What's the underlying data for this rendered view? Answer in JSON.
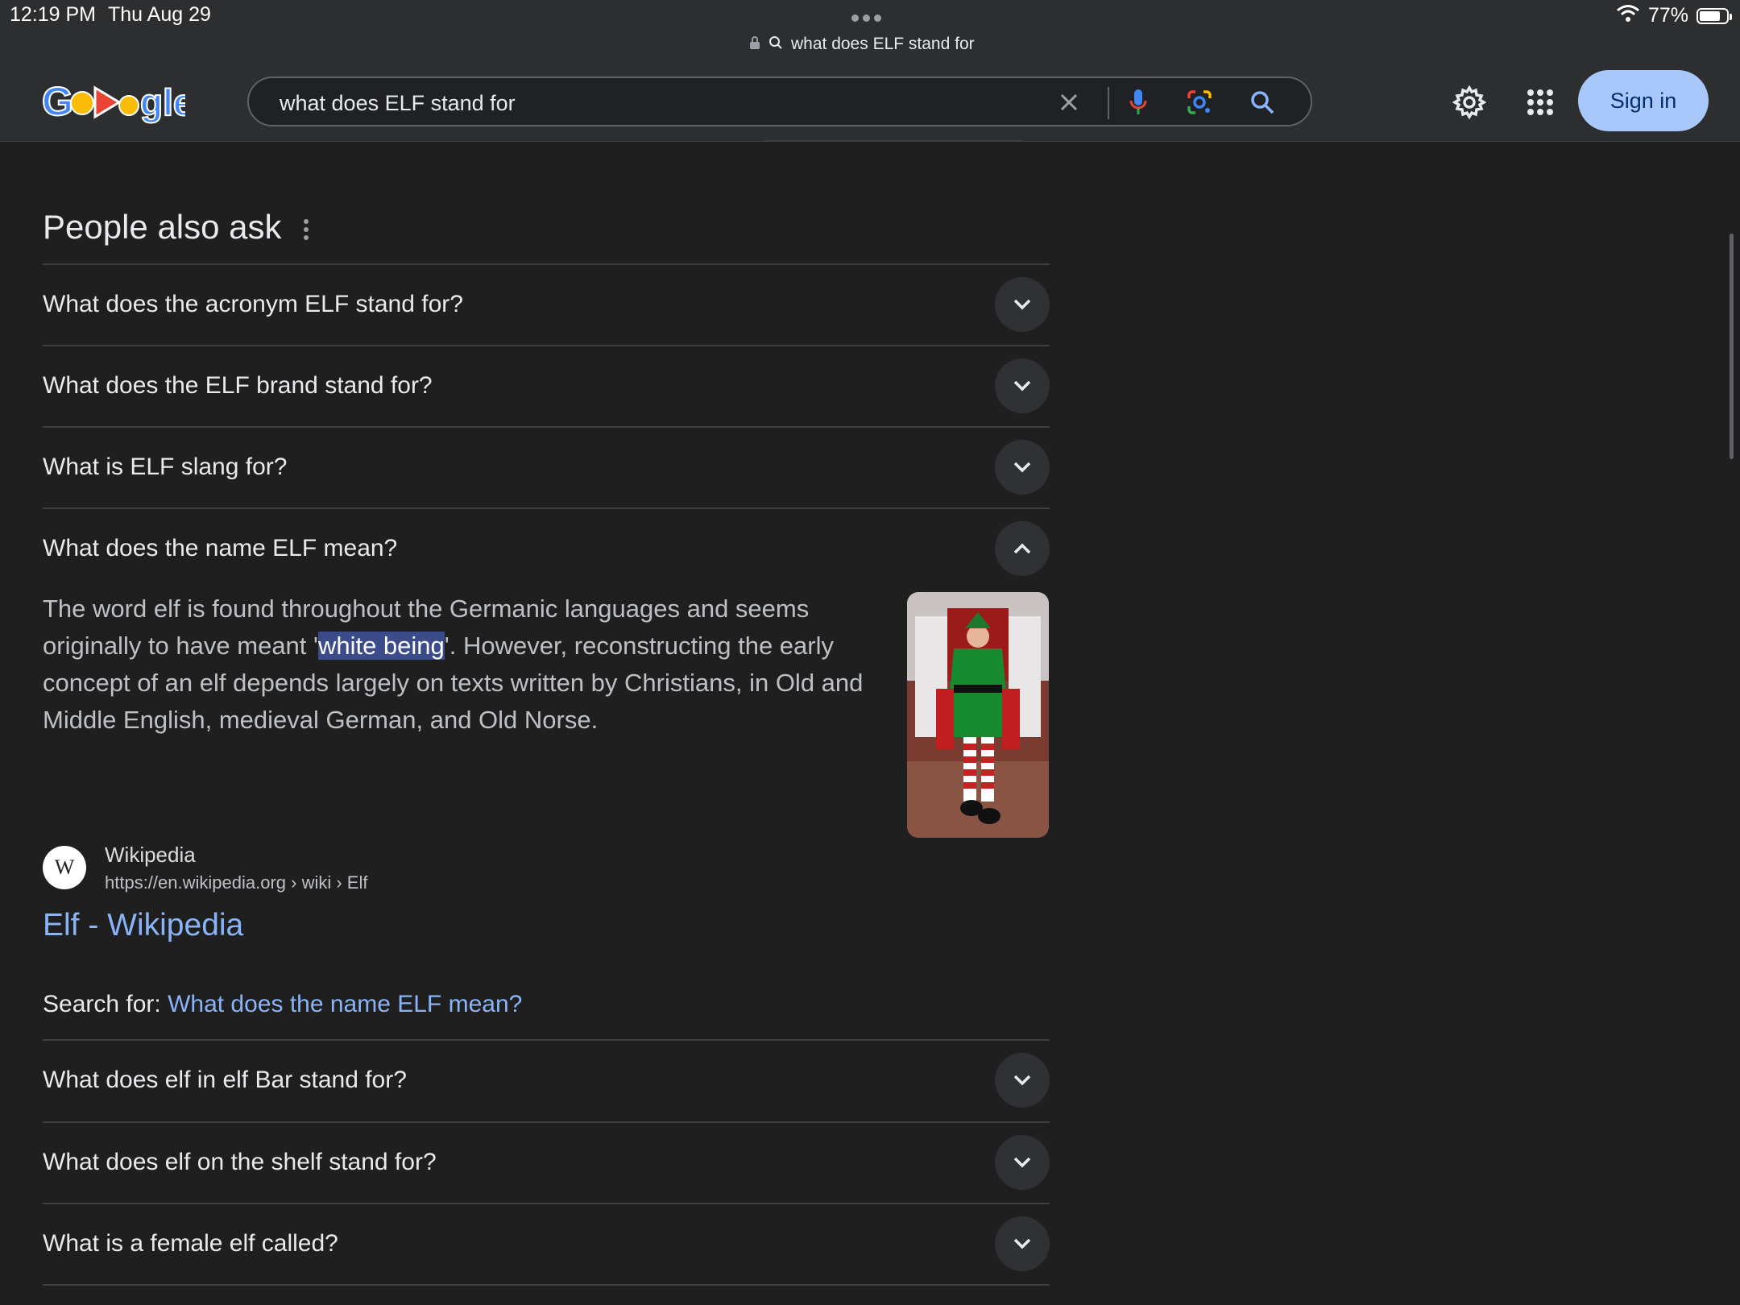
{
  "status_bar": {
    "time": "12:19 PM",
    "date": "Thu Aug 29",
    "url_text": "what does ELF stand for",
    "battery_percent": "77%",
    "battery_level": 0.77
  },
  "header": {
    "search_query": "what does ELF stand for",
    "signin_label": "Sign in"
  },
  "paa": {
    "title": "People also ask",
    "questions_top": [
      "What does the acronym ELF stand for?",
      "What does the ELF brand stand for?",
      "What is ELF slang for?"
    ],
    "expanded": {
      "question": "What does the name ELF mean?",
      "answer_before": "The word elf is found throughout the Germanic languages and seems originally to have meant '",
      "answer_highlight": "white being",
      "answer_after": "'. However, reconstructing the early concept of an elf depends largely on texts written by Christians, in Old and Middle English, medieval German, and Old Norse.",
      "source_name": "Wikipedia",
      "source_url": "https://en.wikipedia.org › wiki › Elf",
      "source_title": "Elf - Wikipedia",
      "search_for_label": "Search for:",
      "search_for_link": "What does the name ELF mean?"
    },
    "questions_bottom": [
      "What does elf in elf Bar stand for?",
      "What does elf on the shelf stand for?",
      "What is a female elf called?"
    ]
  },
  "colors": {
    "background": "#1f1f1f",
    "header_bg": "#2d2e30",
    "link": "#8ab4f8",
    "signin_bg": "#a8c7fa",
    "highlight_bg": "#3c4b8a"
  }
}
